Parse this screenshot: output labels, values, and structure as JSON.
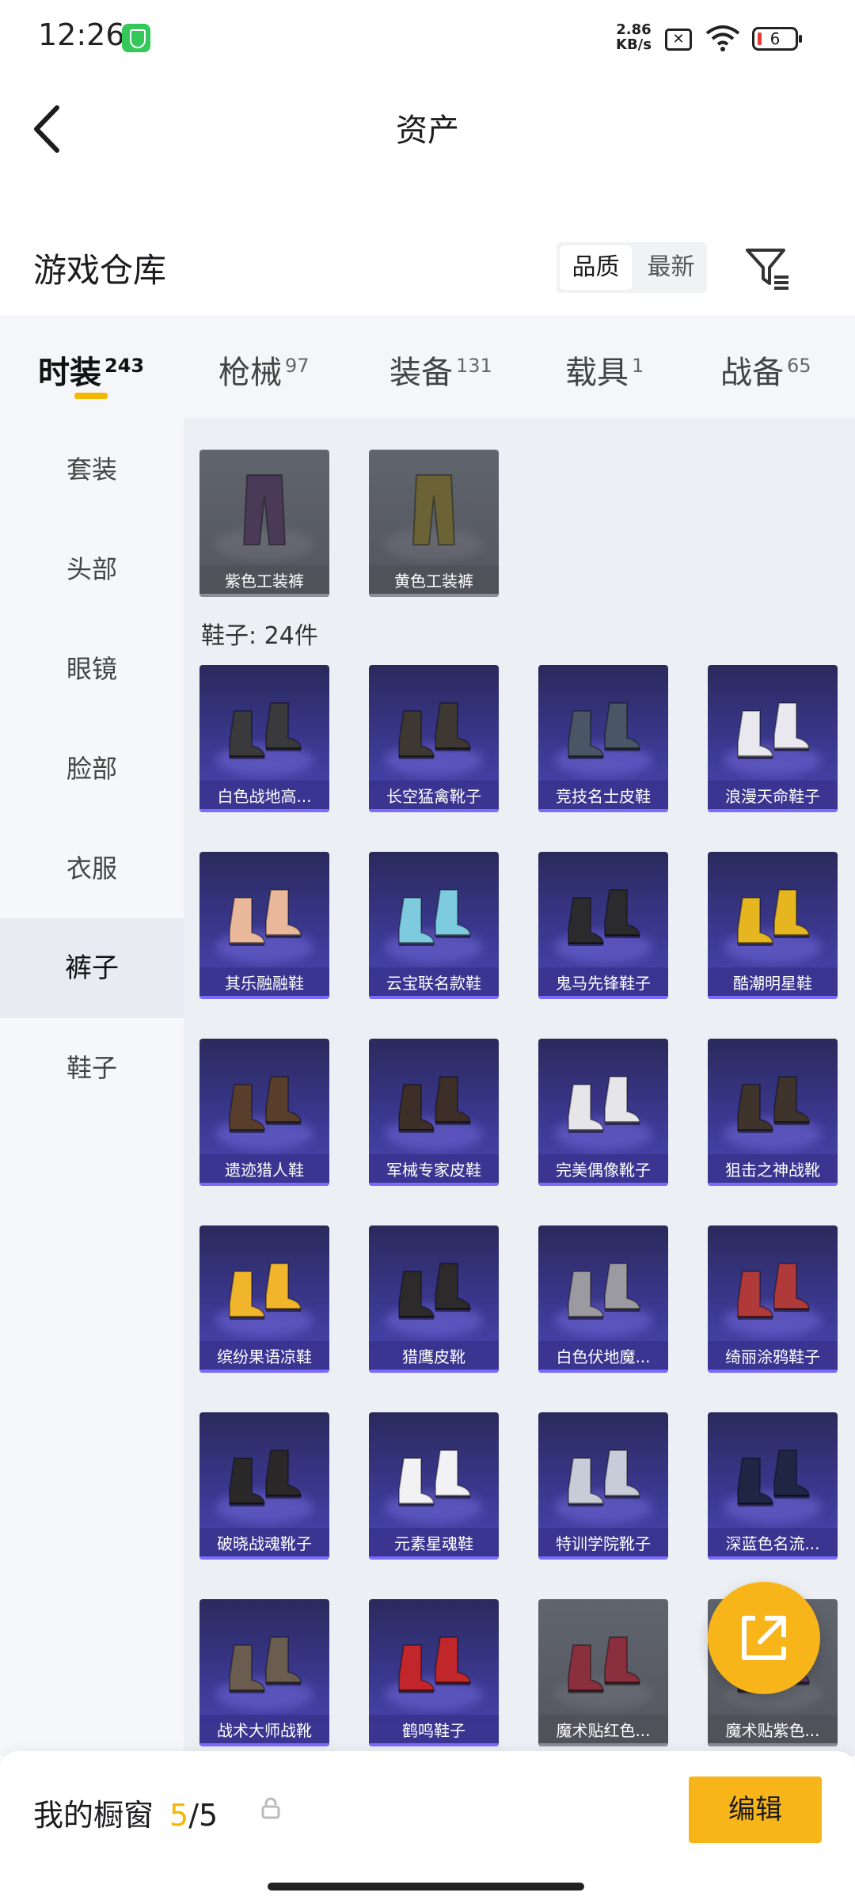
{
  "status_bar": {
    "time": "12:26",
    "net_speed_value": "2.86",
    "net_speed_unit": "KB/s",
    "battery": "6"
  },
  "header": {
    "title": "资产"
  },
  "section": {
    "title": "游戏仓库",
    "sort_options": [
      "品质",
      "最新"
    ],
    "active_sort": "品质"
  },
  "tabs": [
    {
      "label": "时装",
      "count": "243",
      "active": true
    },
    {
      "label": "枪械",
      "count": "97"
    },
    {
      "label": "装备",
      "count": "131"
    },
    {
      "label": "载具",
      "count": "1"
    },
    {
      "label": "战备",
      "count": "65"
    }
  ],
  "sidebar": {
    "items": [
      "套装",
      "头部",
      "眼镜",
      "脸部",
      "衣服",
      "裤子",
      "鞋子"
    ],
    "active": "裤子"
  },
  "pants": [
    {
      "name": "紫色工装裤",
      "color": "#4a3a57"
    },
    {
      "name": "黄色工装裤",
      "color": "#6b6336"
    }
  ],
  "shoes_group": {
    "title": "鞋子: 24件"
  },
  "shoes": [
    {
      "name": "白色战地高...",
      "color": "#3a3a3d"
    },
    {
      "name": "长空猛禽靴子",
      "color": "#3d3832"
    },
    {
      "name": "竞技名士皮鞋",
      "color": "#4a5566"
    },
    {
      "name": "浪漫天命鞋子",
      "color": "#e8e8ee"
    },
    {
      "name": "其乐融融鞋",
      "color": "#e9b89b"
    },
    {
      "name": "云宝联名款鞋",
      "color": "#7ecbe0"
    },
    {
      "name": "鬼马先锋鞋子",
      "color": "#2b2b2e"
    },
    {
      "name": "酷潮明星鞋",
      "color": "#e5b620"
    },
    {
      "name": "遗迹猎人鞋",
      "color": "#5a3e2c"
    },
    {
      "name": "军械专家皮鞋",
      "color": "#3d2e28"
    },
    {
      "name": "完美偶像靴子",
      "color": "#e6e6ea"
    },
    {
      "name": "狙击之神战靴",
      "color": "#3e342c"
    },
    {
      "name": "缤纷果语凉鞋",
      "color": "#f0b52a"
    },
    {
      "name": "猎鹰皮靴",
      "color": "#2d2a2c"
    },
    {
      "name": "白色伏地魔...",
      "color": "#9a9aa0"
    },
    {
      "name": "绮丽涂鸦鞋子",
      "color": "#b03a3a"
    },
    {
      "name": "破晓战魂靴子",
      "color": "#2a2828"
    },
    {
      "name": "元素星魂鞋",
      "color": "#f2f2f4"
    },
    {
      "name": "特训学院靴子",
      "color": "#c8ccd8"
    },
    {
      "name": "深蓝色名流...",
      "color": "#1e2644"
    },
    {
      "name": "战术大师战靴",
      "color": "#6b5c50"
    },
    {
      "name": "鹤鸣鞋子",
      "color": "#c0262a"
    },
    {
      "name": "魔术贴红色...",
      "color": "#8a2f3e",
      "style": "gray"
    },
    {
      "name": "魔术贴紫色...",
      "color": "#5a3a6a",
      "style": "gray"
    }
  ],
  "bottom": {
    "label": "我的橱窗",
    "current": "5",
    "total": "/5",
    "edit_label": "编辑"
  }
}
